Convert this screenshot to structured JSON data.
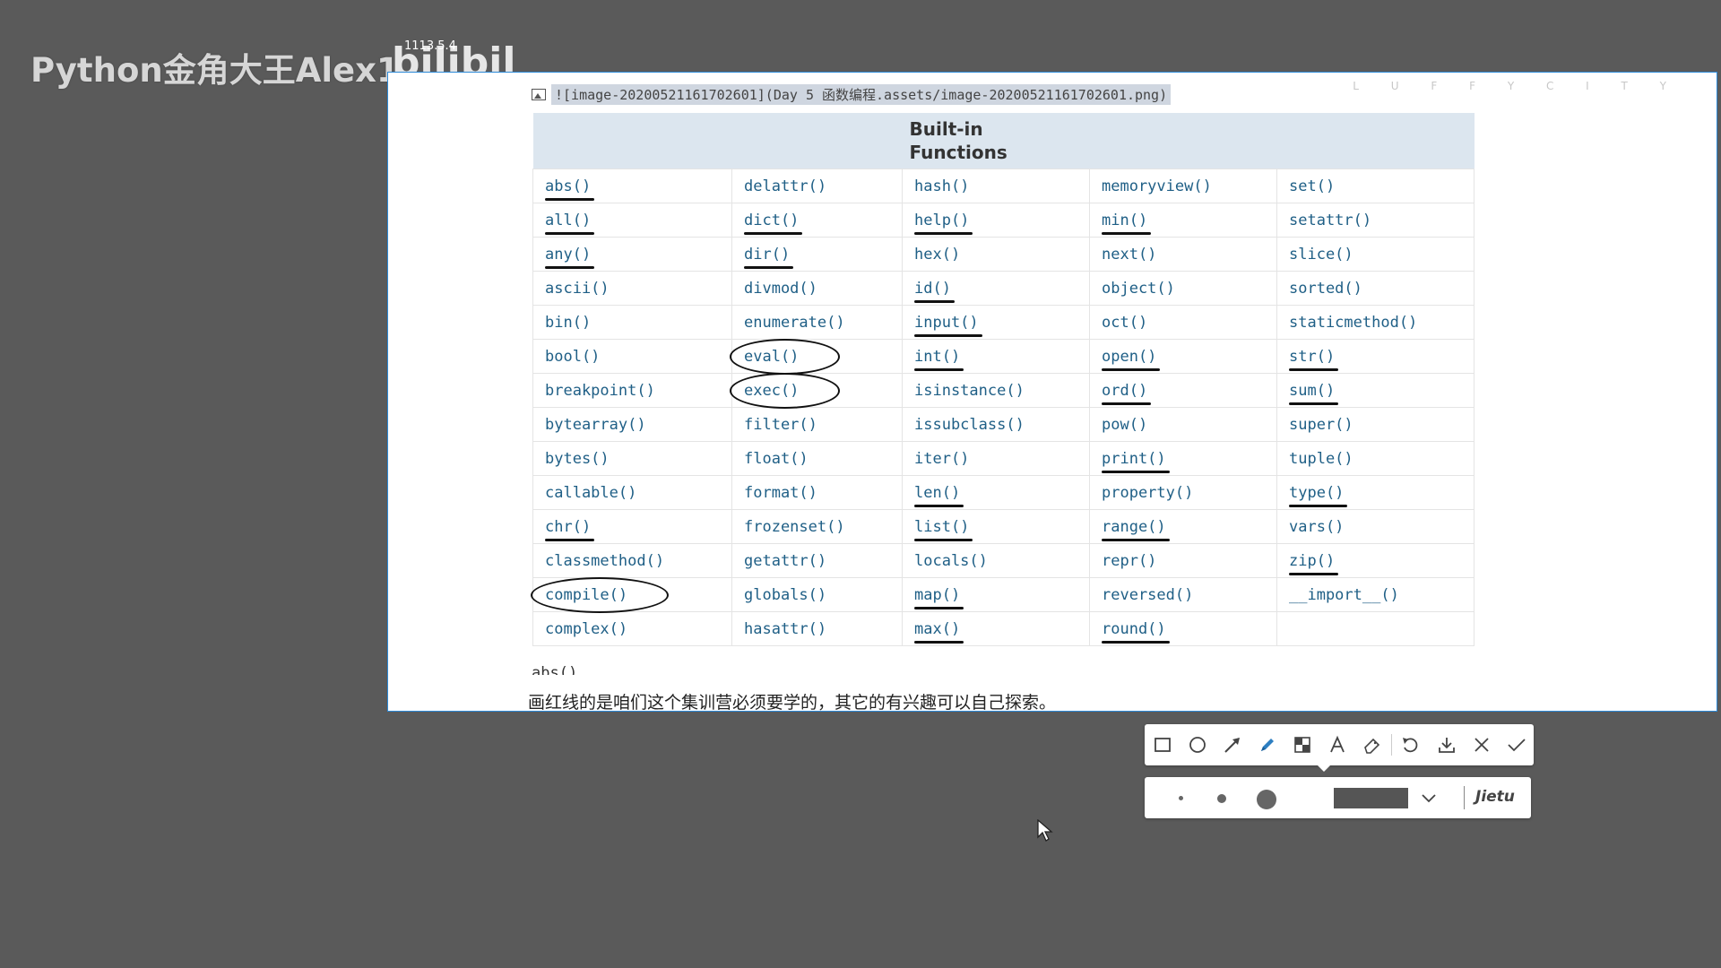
{
  "overlay": {
    "channel_title": "Python金角大王Alex1",
    "bilibili_logo_text": "bilibili",
    "bilibili_count": "1113.5.4"
  },
  "screenshot": {
    "image_link": "![image-20200521161702601](Day 5 函数编程.assets/image-20200521161702601.png)",
    "luffy_mark": "L U F F Y C I T Y",
    "table": {
      "header": "Built-in Functions",
      "rows": [
        [
          "abs()",
          "delattr()",
          "hash()",
          "memoryview()",
          "set()"
        ],
        [
          "all()",
          "dict()",
          "help()",
          "min()",
          "setattr()"
        ],
        [
          "any()",
          "dir()",
          "hex()",
          "next()",
          "slice()"
        ],
        [
          "ascii()",
          "divmod()",
          "id()",
          "object()",
          "sorted()"
        ],
        [
          "bin()",
          "enumerate()",
          "input()",
          "oct()",
          "staticmethod()"
        ],
        [
          "bool()",
          "eval()",
          "int()",
          "open()",
          "str()"
        ],
        [
          "breakpoint()",
          "exec()",
          "isinstance()",
          "ord()",
          "sum()"
        ],
        [
          "bytearray()",
          "filter()",
          "issubclass()",
          "pow()",
          "super()"
        ],
        [
          "bytes()",
          "float()",
          "iter()",
          "print()",
          "tuple()"
        ],
        [
          "callable()",
          "format()",
          "len()",
          "property()",
          "type()"
        ],
        [
          "chr()",
          "frozenset()",
          "list()",
          "range()",
          "vars()"
        ],
        [
          "classmethod()",
          "getattr()",
          "locals()",
          "repr()",
          "zip()"
        ],
        [
          "compile()",
          "globals()",
          "map()",
          "reversed()",
          "__import__()"
        ],
        [
          "complex()",
          "hasattr()",
          "max()",
          "round()",
          ""
        ]
      ],
      "underlined": [
        "abs()",
        "all()",
        "any()",
        "dict()",
        "dir()",
        "help()",
        "min()",
        "id()",
        "input()",
        "int()",
        "open()",
        "str()",
        "ord()",
        "sum()",
        "print()",
        "len()",
        "type()",
        "chr()",
        "list()",
        "range()",
        "zip()",
        "map()",
        "max()",
        "round()"
      ],
      "circled": [
        "eval()",
        "exec()",
        "compile()"
      ]
    },
    "cut_text": "abs()",
    "note": "画红线的是咱们这个集训营必须要学的，其它的有兴趣可以自己探索。"
  },
  "toolbar": {
    "tools": [
      "rectangle-tool",
      "ellipse-tool",
      "arrow-tool",
      "pen-tool",
      "mosaic-tool",
      "text-tool",
      "eraser-tool",
      "undo",
      "download",
      "cancel",
      "confirm"
    ],
    "active_tool": "pen-tool"
  },
  "subbar": {
    "sizes": [
      "small",
      "medium",
      "large"
    ],
    "color": "#555555",
    "brand": "Jietu"
  }
}
